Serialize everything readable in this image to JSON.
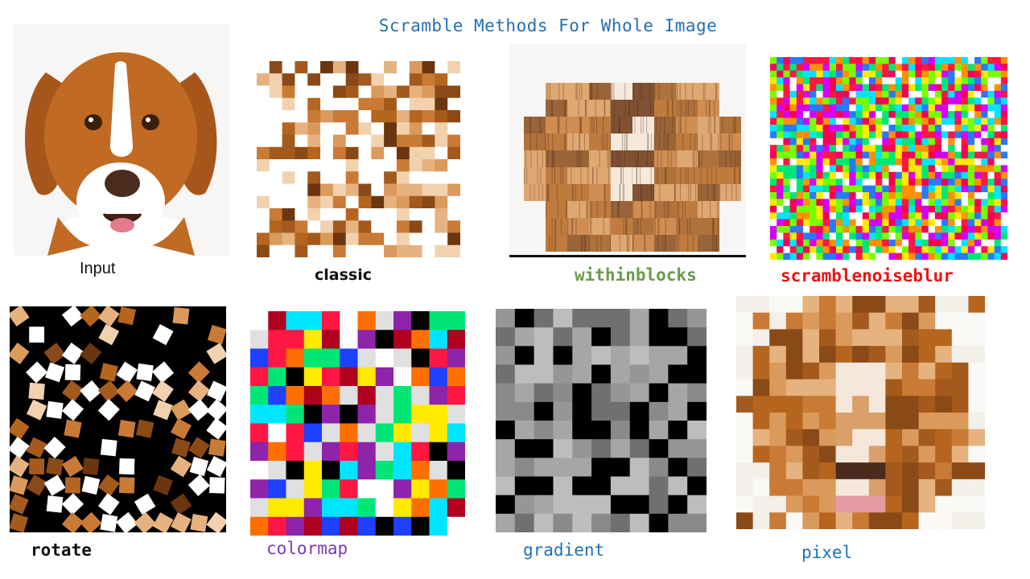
{
  "title": "Scramble Methods For Whole Image",
  "panels": [
    {
      "id": "input",
      "label": "Input",
      "color": "#111111"
    },
    {
      "id": "classic",
      "label": "classic",
      "color": "#111111"
    },
    {
      "id": "withinblocks",
      "label": "withinblocks",
      "color": "#6a9a4e"
    },
    {
      "id": "scramblenoiseblur",
      "label": "scramblenoiseblur",
      "color": "#ee1111"
    },
    {
      "id": "rotate",
      "label": "rotate",
      "color": "#111111"
    },
    {
      "id": "colormap",
      "label": "colormap",
      "color": "#7c3aad"
    },
    {
      "id": "gradient",
      "label": "gradient",
      "color": "#1f6fb5"
    },
    {
      "id": "pixel",
      "label": "pixel",
      "color": "#1f6fb5"
    }
  ],
  "colors": {
    "title": "#1f6fb5",
    "fur": "#b5651d",
    "fur_dark": "#7a3e12",
    "background": "#ffffff"
  }
}
